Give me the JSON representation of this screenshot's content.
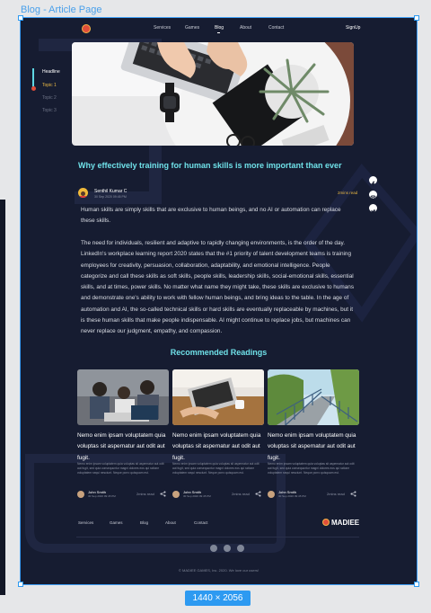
{
  "frame": {
    "label": "Blog - Article Page",
    "size": "1440 × 2056"
  },
  "nav": {
    "links": [
      "Services",
      "Games",
      "Blog",
      "About",
      "Contact"
    ],
    "active": "Blog",
    "signup": "SignUp"
  },
  "toc": {
    "items": [
      "Headline",
      "Topic 1",
      "Topic 2",
      "Topic 3"
    ],
    "active": "Topic 1"
  },
  "article": {
    "title": "Why effectively training for human skills is more important than ever",
    "author": "Senthil Kumar C",
    "date": "30 Sep 2020 09:45 PM",
    "read_time": "2mins read",
    "paragraph1": "Human skills are simply skills that are exclusive to human beings, and no AI or automation can replace these skills.",
    "paragraph2": "The need for individuals, resilient and adaptive to rapidly changing environments, is the order of the day. LinkedIn's workplace learning report 2020 states that the #1 priority of talent development teams is training employees for creativity, persuasion, collaboration, adaptability, and emotional intelligence.  People categorize and call these skills as soft skills, people skills, leadership skills, social-emotional skills, essential skills, and at times, power skills. No matter what name they might take, these skills are exclusive to humans and demonstrate one's ability to work with fellow human beings, and bring ideas to the table. In the age of automation and AI, the so-called technical skills or hard skills are eventually replaceable by machines, but it is these human skills that make people indispensable. AI might continue to replace jobs, but machines can never replace our judgment, empathy, and compassion."
  },
  "share_icons": [
    "facebook-icon",
    "instagram-icon",
    "twitter-icon"
  ],
  "recommended": {
    "heading": "Recommended Readings",
    "cards": [
      {
        "title": "Nemo enim ipsam voluptatem quia voluptas sit aspernatur aut odit aut fugit.",
        "desc": "Nemo enim ipsam voluptatem quia voluptas sit aspernatur aut odit aut fugit, sed quia consequuntur magni dolores eos qui ratione voluptatem sequi nesciunt. Neque porro quisquam est.",
        "author": "John Smith",
        "date": "30 Sep 2020 09:45 PM",
        "read_time": "2mins read"
      },
      {
        "title": "Nemo enim ipsam voluptatem quia voluptas sit aspernatur aut odit aut fugit.",
        "desc": "Nemo enim ipsam voluptatem quia voluptas sit aspernatur aut odit aut fugit, sed quia consequuntur magni dolores eos qui ratione voluptatem sequi nesciunt. Neque porro quisquam est.",
        "author": "John Smith",
        "date": "30 Sep 2020 09:45 PM",
        "read_time": "2mins read"
      },
      {
        "title": "Nemo enim ipsam voluptatem quia voluptas sit aspernatur aut odit aut fugit.",
        "desc": "Nemo enim ipsam voluptatem quia voluptas sit aspernatur aut odit aut fugit, sed quia consequuntur magni dolores eos qui ratione voluptatem sequi nesciunt. Neque porro quisquam est.",
        "author": "John Smith",
        "date": "30 Sep 2020 09:45 PM",
        "read_time": "2mins read"
      }
    ]
  },
  "footer": {
    "links": [
      "Services",
      "Games",
      "Blog",
      "About",
      "Contact"
    ],
    "brand": "MADIEE",
    "social": [
      "facebook-icon",
      "instagram-icon",
      "twitter-icon"
    ],
    "copyright": "© MADIEE GAMES, Inc. 2020. We love our users!"
  },
  "colors": {
    "background": "#161c31",
    "accent": "#6fe0e8",
    "highlight": "#e9b844",
    "brand_red": "#e04e3a",
    "selection": "#2d9af1"
  }
}
